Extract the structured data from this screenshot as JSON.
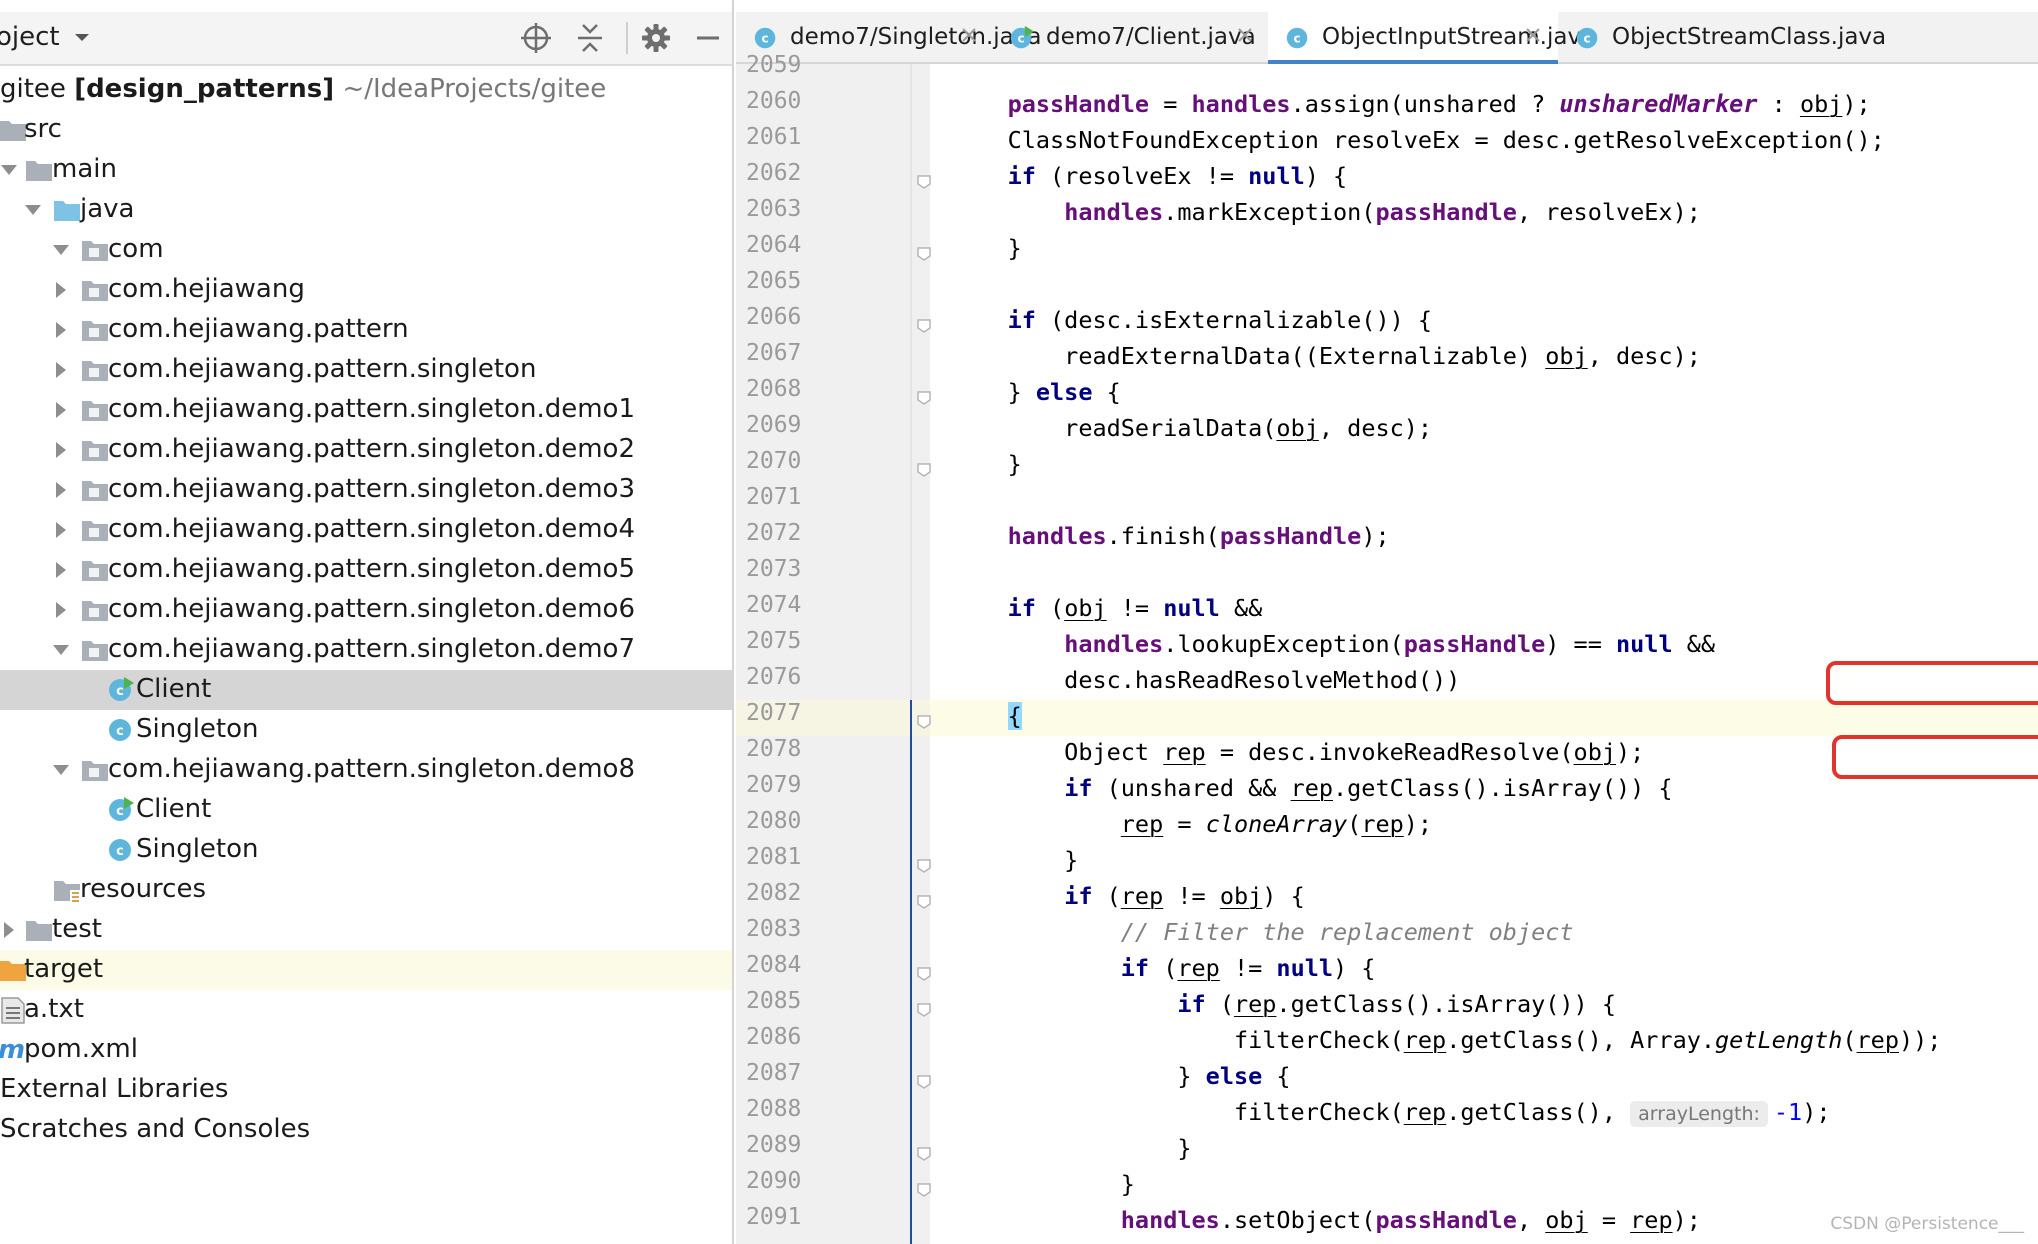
{
  "project": {
    "title": "oject",
    "root": {
      "name": "gitee",
      "module": "[design_patterns]",
      "path": "~/IdeaProjects/gitee"
    },
    "tree": [
      {
        "label": "src",
        "indent": 0,
        "arrow": "none",
        "icon": "folder"
      },
      {
        "label": "main",
        "indent": 1,
        "arrow": "open",
        "icon": "folder"
      },
      {
        "label": "java",
        "indent": 2,
        "arrow": "open",
        "icon": "folder-source"
      },
      {
        "label": "com",
        "indent": 3,
        "arrow": "open",
        "icon": "package"
      },
      {
        "label": "com.hejiawang",
        "indent": 3,
        "arrow": "closed",
        "icon": "package"
      },
      {
        "label": "com.hejiawang.pattern",
        "indent": 3,
        "arrow": "closed",
        "icon": "package"
      },
      {
        "label": "com.hejiawang.pattern.singleton",
        "indent": 3,
        "arrow": "closed",
        "icon": "package"
      },
      {
        "label": "com.hejiawang.pattern.singleton.demo1",
        "indent": 3,
        "arrow": "closed",
        "icon": "package"
      },
      {
        "label": "com.hejiawang.pattern.singleton.demo2",
        "indent": 3,
        "arrow": "closed",
        "icon": "package"
      },
      {
        "label": "com.hejiawang.pattern.singleton.demo3",
        "indent": 3,
        "arrow": "closed",
        "icon": "package"
      },
      {
        "label": "com.hejiawang.pattern.singleton.demo4",
        "indent": 3,
        "arrow": "closed",
        "icon": "package"
      },
      {
        "label": "com.hejiawang.pattern.singleton.demo5",
        "indent": 3,
        "arrow": "closed",
        "icon": "package"
      },
      {
        "label": "com.hejiawang.pattern.singleton.demo6",
        "indent": 3,
        "arrow": "closed",
        "icon": "package"
      },
      {
        "label": "com.hejiawang.pattern.singleton.demo7",
        "indent": 3,
        "arrow": "open",
        "icon": "package"
      },
      {
        "label": "Client",
        "indent": 4,
        "arrow": "none",
        "icon": "class-main",
        "selected": true
      },
      {
        "label": "Singleton",
        "indent": 4,
        "arrow": "none",
        "icon": "class"
      },
      {
        "label": "com.hejiawang.pattern.singleton.demo8",
        "indent": 3,
        "arrow": "open",
        "icon": "package"
      },
      {
        "label": "Client",
        "indent": 4,
        "arrow": "none",
        "icon": "class-main"
      },
      {
        "label": "Singleton",
        "indent": 4,
        "arrow": "none",
        "icon": "class"
      },
      {
        "label": "resources",
        "indent": 2,
        "arrow": "none",
        "icon": "folder-resources"
      },
      {
        "label": "test",
        "indent": 1,
        "arrow": "closed",
        "icon": "folder"
      },
      {
        "label": "target",
        "indent": 0,
        "arrow": "none",
        "icon": "folder-excluded",
        "ignored": true
      },
      {
        "label": "a.txt",
        "indent": 0,
        "arrow": "none",
        "icon": "text-file"
      },
      {
        "label": "pom.xml",
        "indent": 0,
        "arrow": "none",
        "icon": "maven-file"
      },
      {
        "label": "External Libraries",
        "indent": -1,
        "arrow": "none",
        "icon": "none"
      },
      {
        "label": "Scratches and Consoles",
        "indent": -1,
        "arrow": "none",
        "icon": "none"
      }
    ]
  },
  "tabs": [
    {
      "label": "demo7/Singleton.java",
      "icon": "class",
      "active": false
    },
    {
      "label": "demo7/Client.java",
      "icon": "class-main",
      "active": false
    },
    {
      "label": "ObjectInputStream.java",
      "icon": "class",
      "active": true
    },
    {
      "label": "ObjectStreamClass.java",
      "icon": "class",
      "active": false
    }
  ],
  "line_numbers": [
    "2059",
    "2060",
    "2061",
    "2062",
    "2063",
    "2064",
    "2065",
    "2066",
    "2067",
    "2068",
    "2069",
    "2070",
    "2071",
    "2072",
    "2073",
    "2074",
    "2075",
    "2076",
    "2077",
    "2078",
    "2079",
    "2080",
    "2081",
    "2082",
    "2083",
    "2084",
    "2085",
    "2086",
    "2087",
    "2088",
    "2089",
    "2090",
    "2091"
  ],
  "code_lines": [
    {
      "i": 1,
      "segs": [
        [
          "    ",
          ""
        ],
        [
          "passHandle",
          "fld"
        ],
        [
          " = ",
          ""
        ],
        [
          "handles",
          "fld"
        ],
        [
          ".assign(unshared ? ",
          ""
        ],
        [
          "unsharedMarker",
          "itf"
        ],
        [
          " : ",
          ""
        ],
        [
          "obj",
          "u"
        ],
        [
          ");",
          ""
        ]
      ]
    },
    {
      "i": 2,
      "segs": [
        [
          "    ClassNotFoundException resolveEx = desc.getResolveException();",
          ""
        ]
      ]
    },
    {
      "i": 3,
      "segs": [
        [
          "    ",
          ""
        ],
        [
          "if",
          "kw"
        ],
        [
          " (resolveEx != ",
          ""
        ],
        [
          "null",
          "kw"
        ],
        [
          ") {",
          ""
        ]
      ]
    },
    {
      "i": 4,
      "segs": [
        [
          "        ",
          ""
        ],
        [
          "handles",
          "fld"
        ],
        [
          ".markException(",
          ""
        ],
        [
          "passHandle",
          "fld"
        ],
        [
          ", resolveEx);",
          ""
        ]
      ]
    },
    {
      "i": 5,
      "segs": [
        [
          "    }",
          ""
        ]
      ]
    },
    {
      "i": 7,
      "segs": [
        [
          "    ",
          ""
        ],
        [
          "if",
          "kw"
        ],
        [
          " (desc.isExternalizable()) {",
          ""
        ]
      ]
    },
    {
      "i": 8,
      "segs": [
        [
          "        readExternalData((Externalizable) ",
          ""
        ],
        [
          "obj",
          "u"
        ],
        [
          ", desc);",
          ""
        ]
      ]
    },
    {
      "i": 9,
      "segs": [
        [
          "    } ",
          ""
        ],
        [
          "else",
          "kw"
        ],
        [
          " {",
          ""
        ]
      ]
    },
    {
      "i": 10,
      "segs": [
        [
          "        readSerialData(",
          ""
        ],
        [
          "obj",
          "u"
        ],
        [
          ", desc);",
          ""
        ]
      ]
    },
    {
      "i": 11,
      "segs": [
        [
          "    }",
          ""
        ]
      ]
    },
    {
      "i": 13,
      "segs": [
        [
          "    ",
          ""
        ],
        [
          "handles",
          "fld"
        ],
        [
          ".finish(",
          ""
        ],
        [
          "passHandle",
          "fld"
        ],
        [
          ");",
          ""
        ]
      ]
    },
    {
      "i": 15,
      "segs": [
        [
          "    ",
          ""
        ],
        [
          "if",
          "kw"
        ],
        [
          " (",
          ""
        ],
        [
          "obj",
          "u"
        ],
        [
          " != ",
          ""
        ],
        [
          "null",
          "kw"
        ],
        [
          " &&",
          ""
        ]
      ]
    },
    {
      "i": 16,
      "segs": [
        [
          "        ",
          ""
        ],
        [
          "handles",
          "fld"
        ],
        [
          ".lookupException(",
          ""
        ],
        [
          "passHandle",
          "fld"
        ],
        [
          ") == ",
          ""
        ],
        [
          "null",
          "kw"
        ],
        [
          " &&",
          ""
        ]
      ]
    },
    {
      "i": 17,
      "segs": [
        [
          "        desc.hasReadResolveMethod())",
          ""
        ]
      ]
    },
    {
      "i": 18,
      "segs": [
        [
          "    ",
          ""
        ],
        [
          "{",
          "brace"
        ]
      ]
    },
    {
      "i": 19,
      "segs": [
        [
          "        Object ",
          ""
        ],
        [
          "rep",
          "u"
        ],
        [
          " = desc.invokeReadResolve(",
          ""
        ],
        [
          "obj",
          "u"
        ],
        [
          ");",
          ""
        ]
      ]
    },
    {
      "i": 20,
      "segs": [
        [
          "        ",
          ""
        ],
        [
          "if",
          "kw"
        ],
        [
          " (unshared && ",
          ""
        ],
        [
          "rep",
          "u"
        ],
        [
          ".getClass().isArray()) {",
          ""
        ]
      ]
    },
    {
      "i": 21,
      "segs": [
        [
          "            ",
          ""
        ],
        [
          "rep",
          "u"
        ],
        [
          " = ",
          ""
        ],
        [
          "cloneArray",
          "it"
        ],
        [
          "(",
          ""
        ],
        [
          "rep",
          "u"
        ],
        [
          ");",
          ""
        ]
      ]
    },
    {
      "i": 22,
      "segs": [
        [
          "        }",
          ""
        ]
      ]
    },
    {
      "i": 23,
      "segs": [
        [
          "        ",
          ""
        ],
        [
          "if",
          "kw"
        ],
        [
          " (",
          ""
        ],
        [
          "rep",
          "u"
        ],
        [
          " != ",
          ""
        ],
        [
          "obj",
          "u"
        ],
        [
          ") {",
          ""
        ]
      ]
    },
    {
      "i": 24,
      "segs": [
        [
          "            ",
          ""
        ],
        [
          "// Filter the replacement object",
          "cmt"
        ]
      ]
    },
    {
      "i": 25,
      "segs": [
        [
          "            ",
          ""
        ],
        [
          "if",
          "kw"
        ],
        [
          " (",
          ""
        ],
        [
          "rep",
          "u"
        ],
        [
          " != ",
          ""
        ],
        [
          "null",
          "kw"
        ],
        [
          ") {",
          ""
        ]
      ]
    },
    {
      "i": 26,
      "segs": [
        [
          "                ",
          ""
        ],
        [
          "if",
          "kw"
        ],
        [
          " (",
          ""
        ],
        [
          "rep",
          "u"
        ],
        [
          ".getClass().isArray()) {",
          ""
        ]
      ]
    },
    {
      "i": 27,
      "segs": [
        [
          "                    filterCheck(",
          ""
        ],
        [
          "rep",
          "u"
        ],
        [
          ".getClass(), Array.",
          ""
        ],
        [
          "getLength",
          "it"
        ],
        [
          "(",
          ""
        ],
        [
          "rep",
          "u"
        ],
        [
          "));",
          ""
        ]
      ]
    },
    {
      "i": 28,
      "segs": [
        [
          "                } ",
          ""
        ],
        [
          "else",
          "kw"
        ],
        [
          " {",
          ""
        ]
      ]
    },
    {
      "i": 29,
      "segs": [
        [
          "                    filterCheck(",
          ""
        ],
        [
          "rep",
          "u"
        ],
        [
          ".getClass(), ",
          ""
        ],
        [
          "arrayLength:",
          "hint"
        ],
        [
          "-1",
          "num"
        ],
        [
          ");",
          ""
        ]
      ]
    },
    {
      "i": 30,
      "segs": [
        [
          "                }",
          ""
        ]
      ]
    },
    {
      "i": 31,
      "segs": [
        [
          "            }",
          ""
        ]
      ]
    },
    {
      "i": 32,
      "segs": [
        [
          "            ",
          ""
        ],
        [
          "handles",
          "fld"
        ],
        [
          ".setObject(",
          ""
        ],
        [
          "passHandle",
          "fld"
        ],
        [
          ", ",
          ""
        ],
        [
          "obj",
          "u"
        ],
        [
          " = ",
          ""
        ],
        [
          "rep",
          "u"
        ],
        [
          ");",
          ""
        ]
      ]
    }
  ],
  "fold_markers": [
    3,
    5,
    7,
    9,
    11,
    18,
    22,
    23,
    25,
    26,
    28,
    30,
    31
  ],
  "watermark": "CSDN @Persistence___",
  "colors": {
    "keyword": "#000080",
    "field": "#660e7a",
    "comment": "#808080",
    "highlight_box": "#e0342d",
    "active_tab": "#4083c9"
  }
}
